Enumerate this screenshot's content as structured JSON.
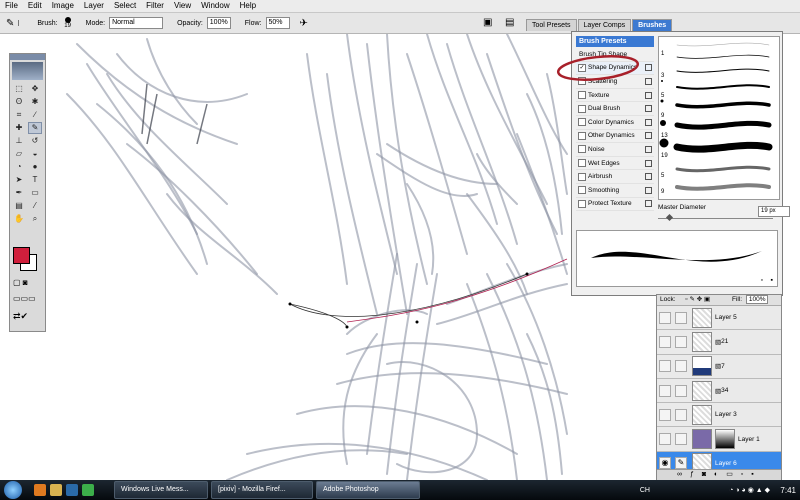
{
  "menubar": {
    "items": [
      "File",
      "Edit",
      "Image",
      "Layer",
      "Select",
      "Filter",
      "View",
      "Window",
      "Help"
    ]
  },
  "options": {
    "brush_label": "Brush:",
    "brush_size": "19",
    "mode_label": "Mode:",
    "mode_value": "Normal",
    "opacity_label": "Opacity:",
    "opacity_value": "100%",
    "flow_label": "Flow:",
    "flow_value": "50%",
    "icons": [
      "brush-tool-icon",
      "airbrush-icon",
      "palette-well-icon"
    ]
  },
  "palette_tabs": [
    "Tool Presets",
    "Layer Comps",
    "Brushes"
  ],
  "brushes": {
    "header": "Brush Presets",
    "items": [
      {
        "label": "Brush Tip Shape",
        "checkbox": false
      },
      {
        "label": "Shape Dynamics",
        "checkbox": true,
        "checked": true
      },
      {
        "label": "Scattering",
        "checkbox": true,
        "checked": false
      },
      {
        "label": "Texture",
        "checkbox": true,
        "checked": false
      },
      {
        "label": "Dual Brush",
        "checkbox": true,
        "checked": false
      },
      {
        "label": "Color Dynamics",
        "checkbox": true,
        "checked": false
      },
      {
        "label": "Other Dynamics",
        "checkbox": true,
        "checked": false
      },
      {
        "label": "Noise",
        "checkbox": true,
        "checked": false
      },
      {
        "label": "Wet Edges",
        "checkbox": true,
        "checked": false
      },
      {
        "label": "Airbrush",
        "checkbox": true,
        "checked": false
      },
      {
        "label": "Smoothing",
        "checkbox": true,
        "checked": false
      },
      {
        "label": "Protect Texture",
        "checkbox": true,
        "checked": false
      }
    ],
    "preset_sizes": [
      "1",
      "3",
      "5",
      "9",
      "13",
      "19",
      "5",
      "9"
    ],
    "master_diameter_label": "Master Diameter",
    "master_diameter_value": "19 px"
  },
  "layers": {
    "lock_label": "Lock:",
    "fill_label": "Fill:",
    "fill_value": "100%",
    "rows": [
      {
        "name": "Layer 5",
        "selected": false
      },
      {
        "name": "21",
        "selected": false
      },
      {
        "name": "7",
        "selected": false
      },
      {
        "name": "34",
        "selected": false
      },
      {
        "name": "Layer 3",
        "selected": false
      },
      {
        "name": "Layer 1",
        "selected": false
      },
      {
        "name": "Layer 6",
        "selected": true
      }
    ]
  },
  "taskbar": {
    "items": [
      {
        "label": "Windows Live Mess...",
        "active": false
      },
      {
        "label": "[pixiv] - Mozilla Firef...",
        "active": false
      },
      {
        "label": "Adobe Photoshop",
        "active": true
      }
    ],
    "tray_lang": "CH",
    "clock": "7:41"
  },
  "colors": {
    "foreground": "#d01f3c",
    "background": "#ffffff",
    "accent": "#3a79d3",
    "highlight_circle": "#a8202a"
  }
}
